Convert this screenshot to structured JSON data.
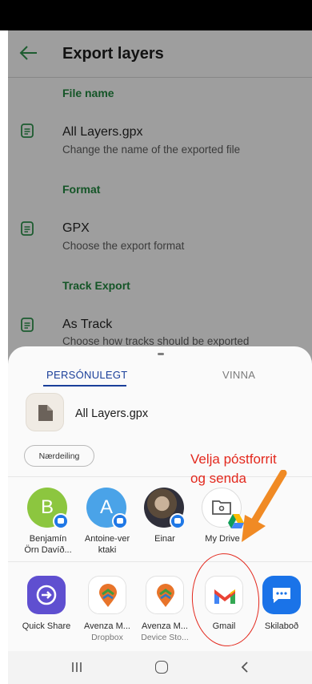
{
  "app": {
    "title": "Export layers",
    "sections": [
      {
        "header": "File name",
        "title": "All Layers.gpx",
        "subtitle": "Change the name of the exported file"
      },
      {
        "header": "Format",
        "title": "GPX",
        "subtitle": "Choose the export format"
      },
      {
        "header": "Track Export",
        "title": "As Track",
        "subtitle": "Choose how tracks should be exported"
      }
    ]
  },
  "share_sheet": {
    "tabs": {
      "personal": "PERSÓNULEGT",
      "work": "VINNA"
    },
    "file_name": "All Layers.gpx",
    "nearby_label": "Nærdeiling",
    "contacts": [
      {
        "label_1": "Benjamín",
        "label_2": "Örn Davíð...",
        "letter": "B",
        "color": "#8cc63f"
      },
      {
        "label_1": "Antoine-ver",
        "label_2": "ktaki",
        "letter": "A",
        "color": "#4aa3e8"
      },
      {
        "label_1": "Einar",
        "label_2": "",
        "letter": "",
        "color": "#6b5b4a"
      },
      {
        "label_1": "My Drive",
        "label_2": "",
        "letter": "",
        "color": "#ffffff"
      }
    ],
    "apps": [
      {
        "label": "Quick Share",
        "sub": "",
        "color": "#5f4fd0"
      },
      {
        "label": "Avenza M...",
        "sub": "Dropbox",
        "color": "#ffffff"
      },
      {
        "label": "Avenza M...",
        "sub": "Device Sto...",
        "color": "#ffffff"
      },
      {
        "label": "Gmail",
        "sub": "",
        "color": "#ffffff"
      },
      {
        "label": "Skilaboð",
        "sub": "",
        "color": "#1a73e8"
      }
    ]
  },
  "annotation": {
    "line_1": "Velja póstforrit",
    "line_2": "og senda",
    "color": "#e3281d"
  }
}
